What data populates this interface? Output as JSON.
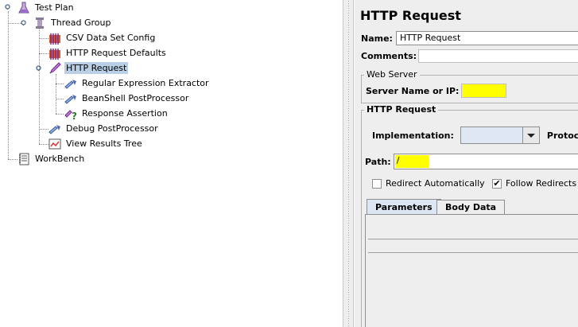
{
  "tree": {
    "test_plan": "Test Plan",
    "thread_group": "Thread Group",
    "csv": "CSV Data Set Config",
    "defaults": "HTTP Request Defaults",
    "http_request": "HTTP Request",
    "regex": "Regular Expression Extractor",
    "beanshell": "BeanShell PostProcessor",
    "assertion": "Response Assertion",
    "debug": "Debug PostProcessor",
    "results": "View Results Tree",
    "workbench": "WorkBench"
  },
  "panel": {
    "title": "HTTP Request",
    "name_label": "Name:",
    "name_value": "HTTP Request",
    "comments_label": "Comments:",
    "web_server_title": "Web Server",
    "server_label": "Server Name or IP:",
    "server_value": "",
    "http_request_title": "HTTP Request",
    "implementation_label": "Implementation:",
    "protocol_label": "Protocol",
    "path_label": "Path:",
    "path_value": "/",
    "redirect_auto": "Redirect Automatically",
    "follow_redirects": "Follow Redirects",
    "follow_checked": true,
    "tabs": [
      "Parameters",
      "Body Data"
    ]
  },
  "colors": {
    "highlight": "#ffff00",
    "selection": "#b8cfe5",
    "panel_bg": "#eeeeee"
  }
}
